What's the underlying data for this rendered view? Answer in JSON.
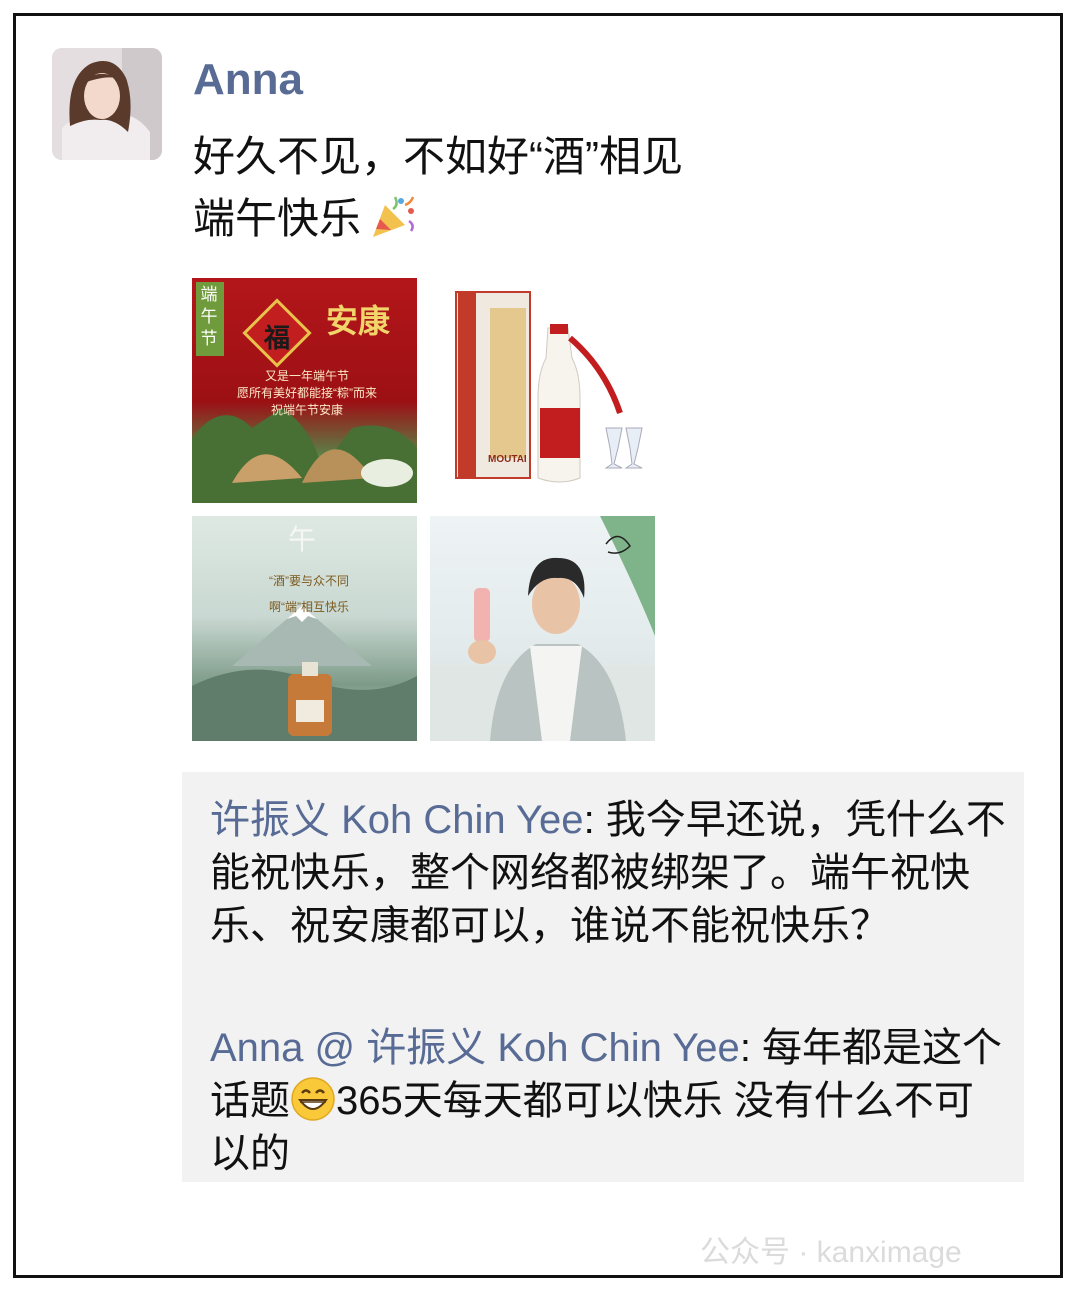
{
  "post": {
    "author": "Anna",
    "line1": "好久不见，不如好“酒”相见",
    "line2": "端午快乐"
  },
  "images": {
    "tile1": {
      "badge": "端午节",
      "fu": "福",
      "title_chars": "安康",
      "caption_lines": [
        "又是一年端午节",
        "愿所有美好都能接“粽”而来",
        "祝端午节安康"
      ]
    },
    "tile2": {
      "brand": "MOUTAI"
    },
    "tile3": {
      "heading": "午",
      "lines": [
        "“酒”要与众不同",
        "啊“端”相互快乐"
      ]
    },
    "tile4": {}
  },
  "comments": [
    {
      "name": "许振义 Koh Chin Yee",
      "text": ": 我今早还说，凭什么不能祝快乐，整个网络都被绑架了。端午祝快乐、祝安康都可以，谁说不能祝快乐？"
    },
    {
      "name": "Anna @ 许振义 Koh Chin Yee",
      "text_before": ": 每年都是这个话题",
      "text_after": "365天每天都可以快乐 没有什么不可以的"
    }
  ],
  "watermark": "公众号 · kanximage"
}
